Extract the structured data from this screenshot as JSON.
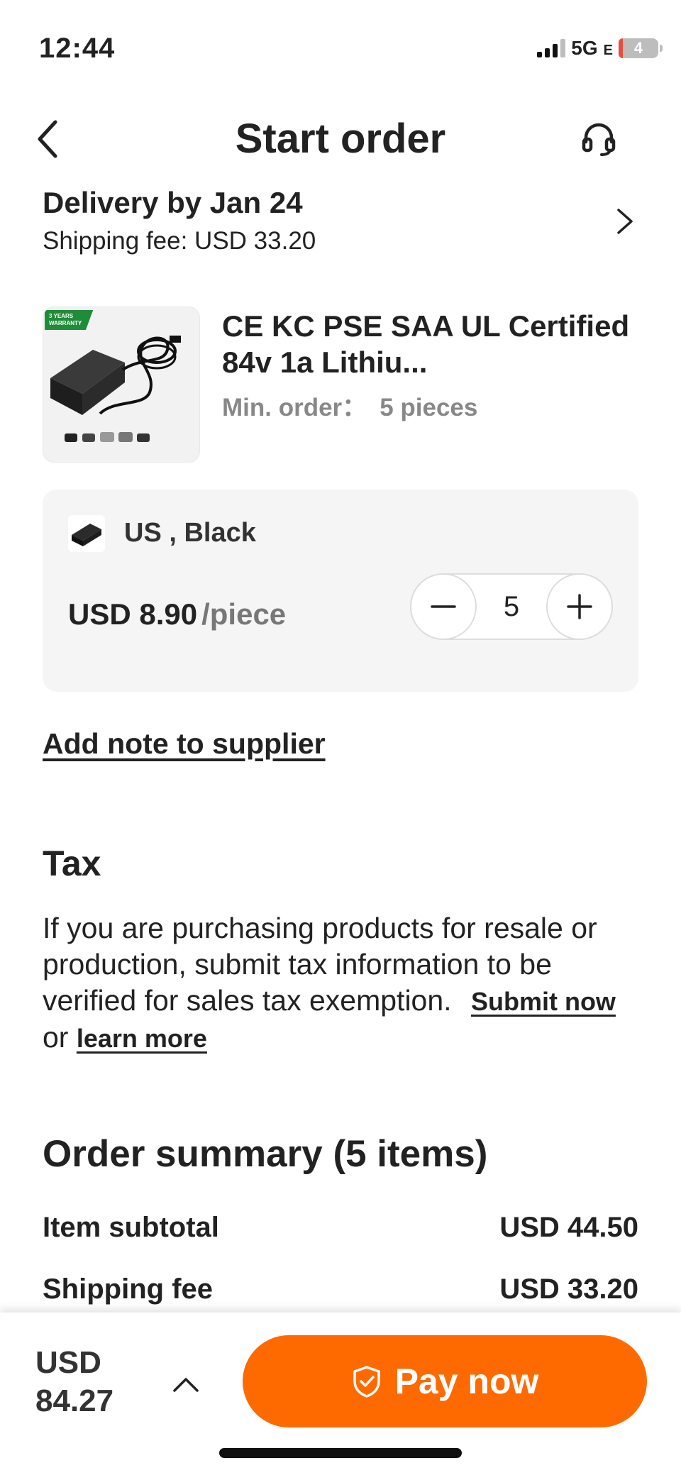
{
  "status_bar": {
    "time": "12:44",
    "network": "5G",
    "network_suffix": "E",
    "battery": "4"
  },
  "header": {
    "title": "Start order",
    "back_icon": "chevron-left-icon",
    "support_icon": "headset-icon"
  },
  "delivery": {
    "title": "Delivery by Jan 24",
    "fee": "Shipping fee: USD 33.20"
  },
  "product": {
    "badge_line1": "3 YEARS",
    "badge_line2": "WARRANTY",
    "title": "CE KC PSE SAA UL Certified 84v 1a Lithiu...",
    "min_order_label": "Min. order：",
    "min_order_qty": "5 pieces"
  },
  "variant": {
    "label": "US , Black",
    "price": "USD 8.90",
    "unit": "/piece",
    "quantity": "5"
  },
  "note": {
    "label": "Add note to supplier"
  },
  "tax": {
    "heading": "Tax",
    "text": "If you are purchasing products for resale or production, submit tax information to be verified for sales tax exemption.",
    "submit_link": "Submit now",
    "or_text": "or",
    "learn_link": "learn more"
  },
  "summary": {
    "heading": "Order summary (5 items)",
    "rows": [
      {
        "label": "Item subtotal",
        "value": "USD 44.50"
      },
      {
        "label": "Shipping fee",
        "value": "USD 33.20"
      }
    ]
  },
  "footer": {
    "total_currency": "USD",
    "total_amount": "84.27",
    "pay_label": "Pay now"
  },
  "colors": {
    "accent": "#ff6a00",
    "card_bg": "#f5f5f5",
    "muted_text": "#888888"
  }
}
